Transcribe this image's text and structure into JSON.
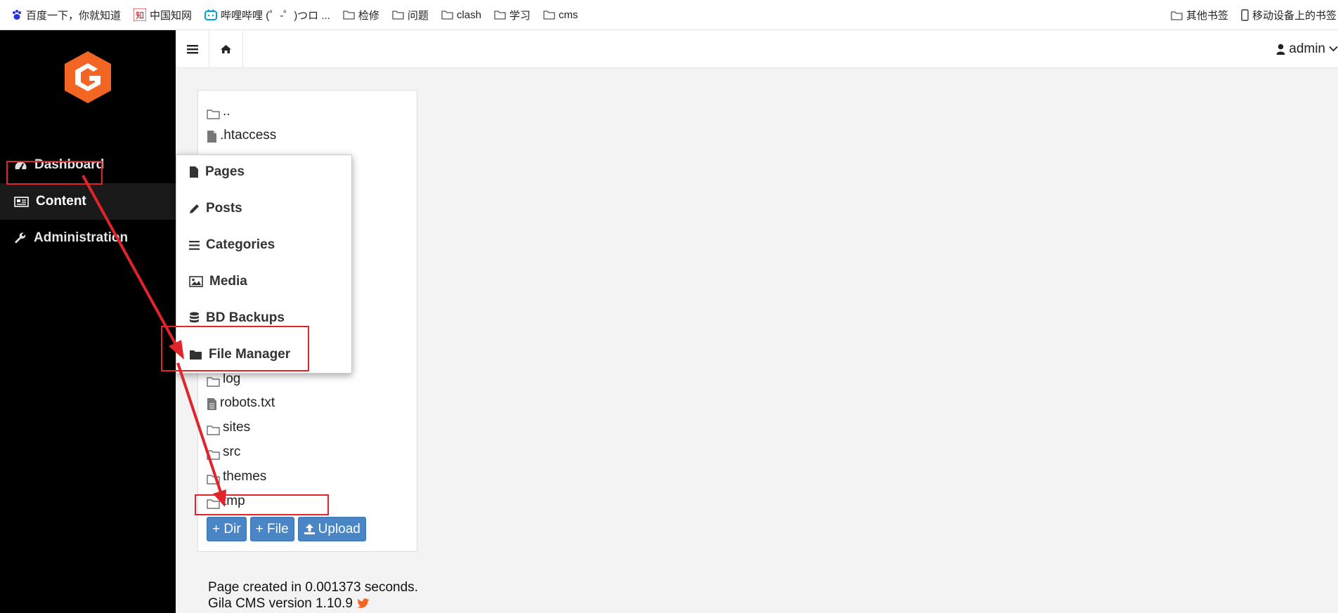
{
  "bookmarks": {
    "items": [
      {
        "label": "百度一下，你就知道",
        "icon": "baidu-paw-icon"
      },
      {
        "label": "中国知网",
        "icon": "cnki-icon"
      },
      {
        "label": "哔哩哔哩 (゜-゜)つロ ...",
        "icon": "bilibili-icon"
      },
      {
        "label": "检修",
        "icon": "folder-icon"
      },
      {
        "label": "问题",
        "icon": "folder-icon"
      },
      {
        "label": "clash",
        "icon": "folder-icon"
      },
      {
        "label": "学习",
        "icon": "folder-icon"
      },
      {
        "label": "cms",
        "icon": "folder-icon"
      }
    ],
    "other": "其他书签",
    "mobile": "移动设备上的书签"
  },
  "sidebar": {
    "items": [
      {
        "label": "Dashboard",
        "icon": "dashboard-icon"
      },
      {
        "label": "Content",
        "icon": "newspaper-icon"
      },
      {
        "label": "Administration",
        "icon": "wrench-icon"
      }
    ]
  },
  "topbar": {
    "user": "admin"
  },
  "content_menu": {
    "items": [
      {
        "label": "Pages",
        "icon": "file-icon"
      },
      {
        "label": "Posts",
        "icon": "pencil-icon"
      },
      {
        "label": "Categories",
        "icon": "list-icon"
      },
      {
        "label": "Media",
        "icon": "image-icon"
      },
      {
        "label": "BD Backups",
        "icon": "database-icon"
      },
      {
        "label": "File Manager",
        "icon": "folder-icon"
      }
    ]
  },
  "file_manager": {
    "entries": [
      {
        "name": "..",
        "type": "dir"
      },
      {
        "name": ".htaccess",
        "type": "file"
      },
      {
        "name": "log",
        "type": "dir"
      },
      {
        "name": "robots.txt",
        "type": "file"
      },
      {
        "name": "sites",
        "type": "dir"
      },
      {
        "name": "src",
        "type": "dir"
      },
      {
        "name": "themes",
        "type": "dir"
      },
      {
        "name": "tmp",
        "type": "dir"
      }
    ],
    "buttons": {
      "dir": "+ Dir",
      "file": "+ File",
      "upload": "Upload"
    }
  },
  "footer": {
    "created": "Page created in 0.001373 seconds.",
    "version": "Gila CMS version 1.10.9"
  },
  "colors": {
    "annotation": "#e0242a",
    "button": "#4a86c5",
    "logo": "#f26522"
  }
}
